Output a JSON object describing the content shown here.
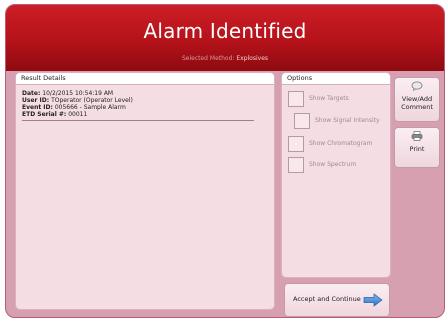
{
  "header": {
    "title": "Alarm Identified",
    "method_label": "Selected Method:",
    "method_value": "Explosives"
  },
  "result_details": {
    "title": "Result Details",
    "rows": [
      {
        "label": "Date:",
        "value": "10/2/2015 10:54:19 AM"
      },
      {
        "label": "User ID:",
        "value": "TOperator (Operator  Level)"
      },
      {
        "label": "Event ID:",
        "value": "005666 - Sample Alarm"
      },
      {
        "label": "ETD Serial #:",
        "value": "00011"
      }
    ]
  },
  "options": {
    "title": "Options",
    "items": [
      {
        "label": "Show Targets",
        "checked": false
      },
      {
        "label": "Show Signal Intensity",
        "checked": false
      },
      {
        "label": "Show Chromatogram",
        "checked": false
      },
      {
        "label": "Show Spectrum",
        "checked": false
      }
    ]
  },
  "buttons": {
    "view_add_line1": "View/Add",
    "view_add_line2": "Comment",
    "print": "Print",
    "accept": "Accept and Continue"
  },
  "colors": {
    "header_red": "#b5121a",
    "panel_pink": "#f4dde3",
    "background_pink": "#d7a0b0",
    "arrow_blue": "#3a86d6"
  },
  "icons": {
    "comment": "speech-bubble-icon",
    "print": "printer-icon",
    "accept": "arrow-right-icon"
  }
}
